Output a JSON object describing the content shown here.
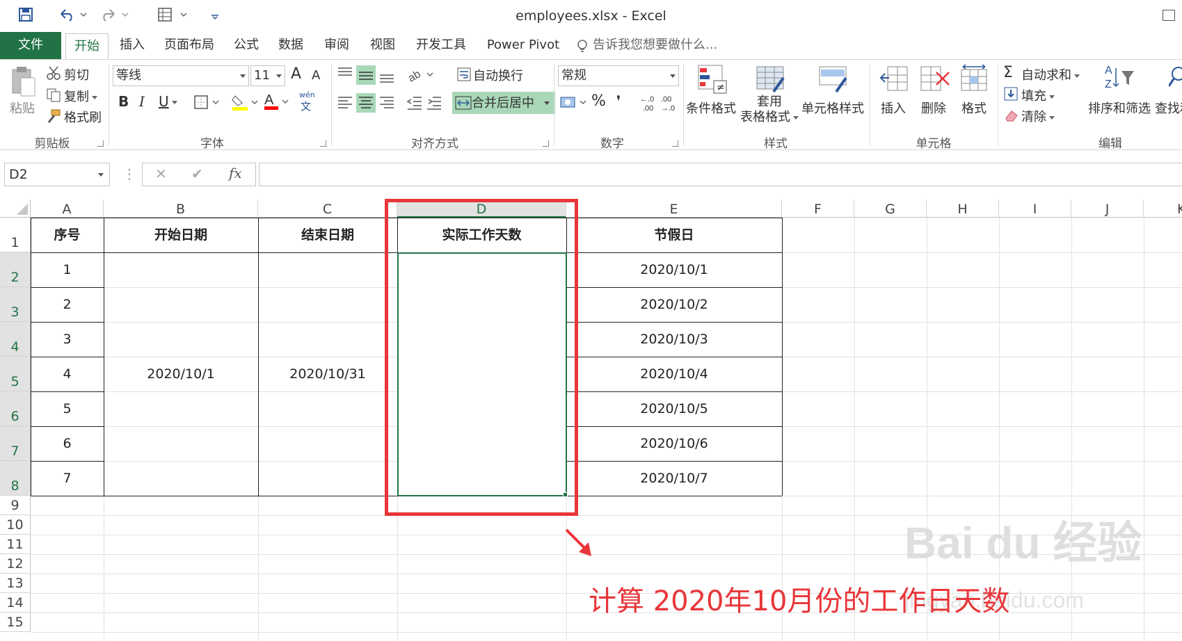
{
  "window": {
    "title": "employees.xlsx - Excel"
  },
  "tabs": [
    "文件",
    "开始",
    "插入",
    "页面布局",
    "公式",
    "数据",
    "审阅",
    "视图",
    "开发工具",
    "Power Pivot"
  ],
  "tell_me": "告诉我您想要做什么...",
  "ribbon": {
    "clipboard": {
      "paste": "粘贴",
      "cut": "剪切",
      "copy": "复制",
      "format_painter": "格式刷",
      "label": "剪贴板"
    },
    "font": {
      "name": "等线",
      "size": "11",
      "bold": "B",
      "italic": "I",
      "underline": "U",
      "label": "字体",
      "grow": "A",
      "shrink": "A",
      "phonetic_top": "wén",
      "phonetic_bottom": "文"
    },
    "alignment": {
      "wrap": "自动换行",
      "merge": "合并后居中",
      "label": "对齐方式"
    },
    "number": {
      "format": "常规",
      "percent": "%",
      "comma": "❜",
      "inc_dec": "←.0\n.00",
      "label": "数字"
    },
    "styles": {
      "conditional": "条件格式",
      "table_top": "套用",
      "table_bottom": "表格格式",
      "cell_styles": "单元格样式",
      "label": "样式"
    },
    "cells": {
      "insert": "插入",
      "delete": "删除",
      "format": "格式",
      "label": "单元格"
    },
    "editing": {
      "autosum": "自动求和",
      "fill": "填充",
      "clear": "清除",
      "sort": "排序和筛选",
      "find": "查找和",
      "label": "编辑"
    }
  },
  "formula_bar": {
    "name_box": "D2",
    "fx": "fx",
    "formula": ""
  },
  "columns": [
    "A",
    "B",
    "C",
    "D",
    "E",
    "F",
    "G",
    "H",
    "I",
    "J",
    "K"
  ],
  "rows": [
    "1",
    "2",
    "3",
    "4",
    "5",
    "6",
    "7",
    "8",
    "9",
    "10",
    "11",
    "12",
    "13",
    "14",
    "15"
  ],
  "sheet": {
    "headers": {
      "A1": "序号",
      "B1": "开始日期",
      "C1": "结束日期",
      "D1": "实际工作天数",
      "E1": "节假日"
    },
    "index": [
      "1",
      "2",
      "3",
      "4",
      "5",
      "6",
      "7"
    ],
    "start_date": "2020/10/1",
    "end_date": "2020/10/31",
    "holidays": [
      "2020/10/1",
      "2020/10/2",
      "2020/10/3",
      "2020/10/4",
      "2020/10/5",
      "2020/10/6",
      "2020/10/7"
    ]
  },
  "annotation": "计算 2020年10月份的工作日天数",
  "watermark": {
    "logo": "Bai du 经验",
    "url": "jingyan.baidu.com"
  },
  "colors": {
    "excel_green": "#217346",
    "annotation_red": "#e8363a"
  }
}
